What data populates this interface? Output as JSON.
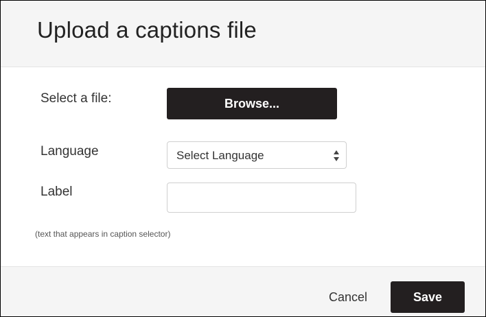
{
  "dialog": {
    "title": "Upload a captions file"
  },
  "form": {
    "file_label": "Select a file:",
    "browse_label": "Browse...",
    "language_label": "Language",
    "language_selected": "Select Language",
    "caption_label": "Label",
    "caption_value": "",
    "caption_help": "(text that appears in caption selector)"
  },
  "footer": {
    "cancel_label": "Cancel",
    "save_label": "Save"
  },
  "icons": {
    "select_arrows": "up-down-arrows-icon"
  },
  "colors": {
    "button_background": "#231f20",
    "button_text": "#ffffff",
    "header_background": "#f5f5f5"
  }
}
